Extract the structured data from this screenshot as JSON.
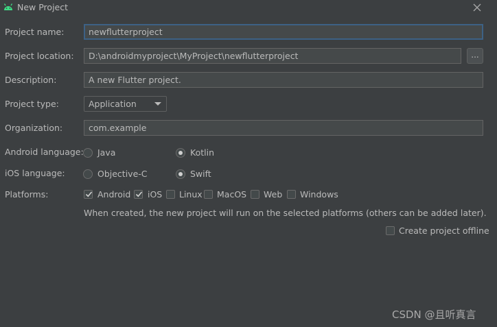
{
  "window": {
    "title": "New Project",
    "icon": "android-icon",
    "close_icon": "close-icon"
  },
  "form": {
    "project_name": {
      "label": "Project name:",
      "value": "newflutterproject"
    },
    "project_location": {
      "label": "Project location:",
      "value": "D:\\androidmyproject\\MyProject\\newflutterproject",
      "browse_label": "..."
    },
    "description": {
      "label": "Description:",
      "value": "A new Flutter project."
    },
    "project_type": {
      "label": "Project type:",
      "value": "Application"
    },
    "organization": {
      "label": "Organization:",
      "value": "com.example"
    },
    "android_language": {
      "label": "Android language:",
      "options": [
        "Java",
        "Kotlin"
      ],
      "selected": "Kotlin"
    },
    "ios_language": {
      "label": "iOS language:",
      "options": [
        "Objective-C",
        "Swift"
      ],
      "selected": "Swift"
    },
    "platforms": {
      "label": "Platforms:",
      "options": [
        {
          "name": "Android",
          "checked": true
        },
        {
          "name": "iOS",
          "checked": true
        },
        {
          "name": "Linux",
          "checked": false
        },
        {
          "name": "MacOS",
          "checked": false
        },
        {
          "name": "Web",
          "checked": false
        },
        {
          "name": "Windows",
          "checked": false
        }
      ],
      "hint": "When created, the new project will run on the selected platforms (others can be added later)."
    },
    "create_offline": {
      "label": "Create project offline",
      "checked": false
    }
  },
  "watermark": "CSDN @且听真言",
  "colors": {
    "background": "#3c3f41",
    "field_background": "#45494a",
    "focus_border": "#3d6185",
    "android_green": "#3ddc84",
    "text": "#bbbbbb"
  }
}
